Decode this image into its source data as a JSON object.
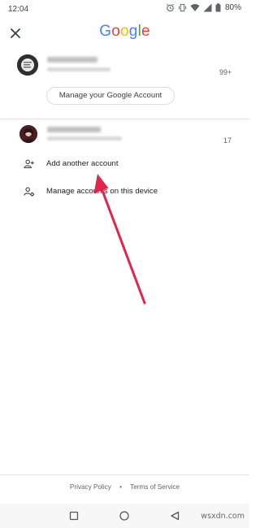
{
  "status_bar": {
    "time": "12:04",
    "battery": "80%",
    "icons": [
      "alarm-icon",
      "vibrate-icon",
      "wifi-icon",
      "signal-icon",
      "battery-icon"
    ]
  },
  "header": {
    "logo_letters": [
      {
        "char": "G",
        "color": "#4285F4"
      },
      {
        "char": "o",
        "color": "#EA4335"
      },
      {
        "char": "o",
        "color": "#FBBC05"
      },
      {
        "char": "g",
        "color": "#4285F4"
      },
      {
        "char": "l",
        "color": "#34A853"
      },
      {
        "char": "e",
        "color": "#EA4335"
      }
    ],
    "close_icon": "close-icon"
  },
  "primary_account": {
    "notification_count": "99+",
    "manage_button_label": "Manage your Google Account"
  },
  "other_account": {
    "notification_count": "17"
  },
  "actions": {
    "add_account_label": "Add another account",
    "manage_accounts_label": "Manage accounts on this device"
  },
  "footer": {
    "privacy_label": "Privacy Policy",
    "separator": "•",
    "terms_label": "Terms of Service"
  },
  "nav_bar": {
    "icons": [
      "recents-icon",
      "home-icon",
      "back-icon"
    ]
  },
  "watermark": "wsxdn.com",
  "colors": {
    "arrow": "#E0264A",
    "divider": "#e3e3e3"
  }
}
